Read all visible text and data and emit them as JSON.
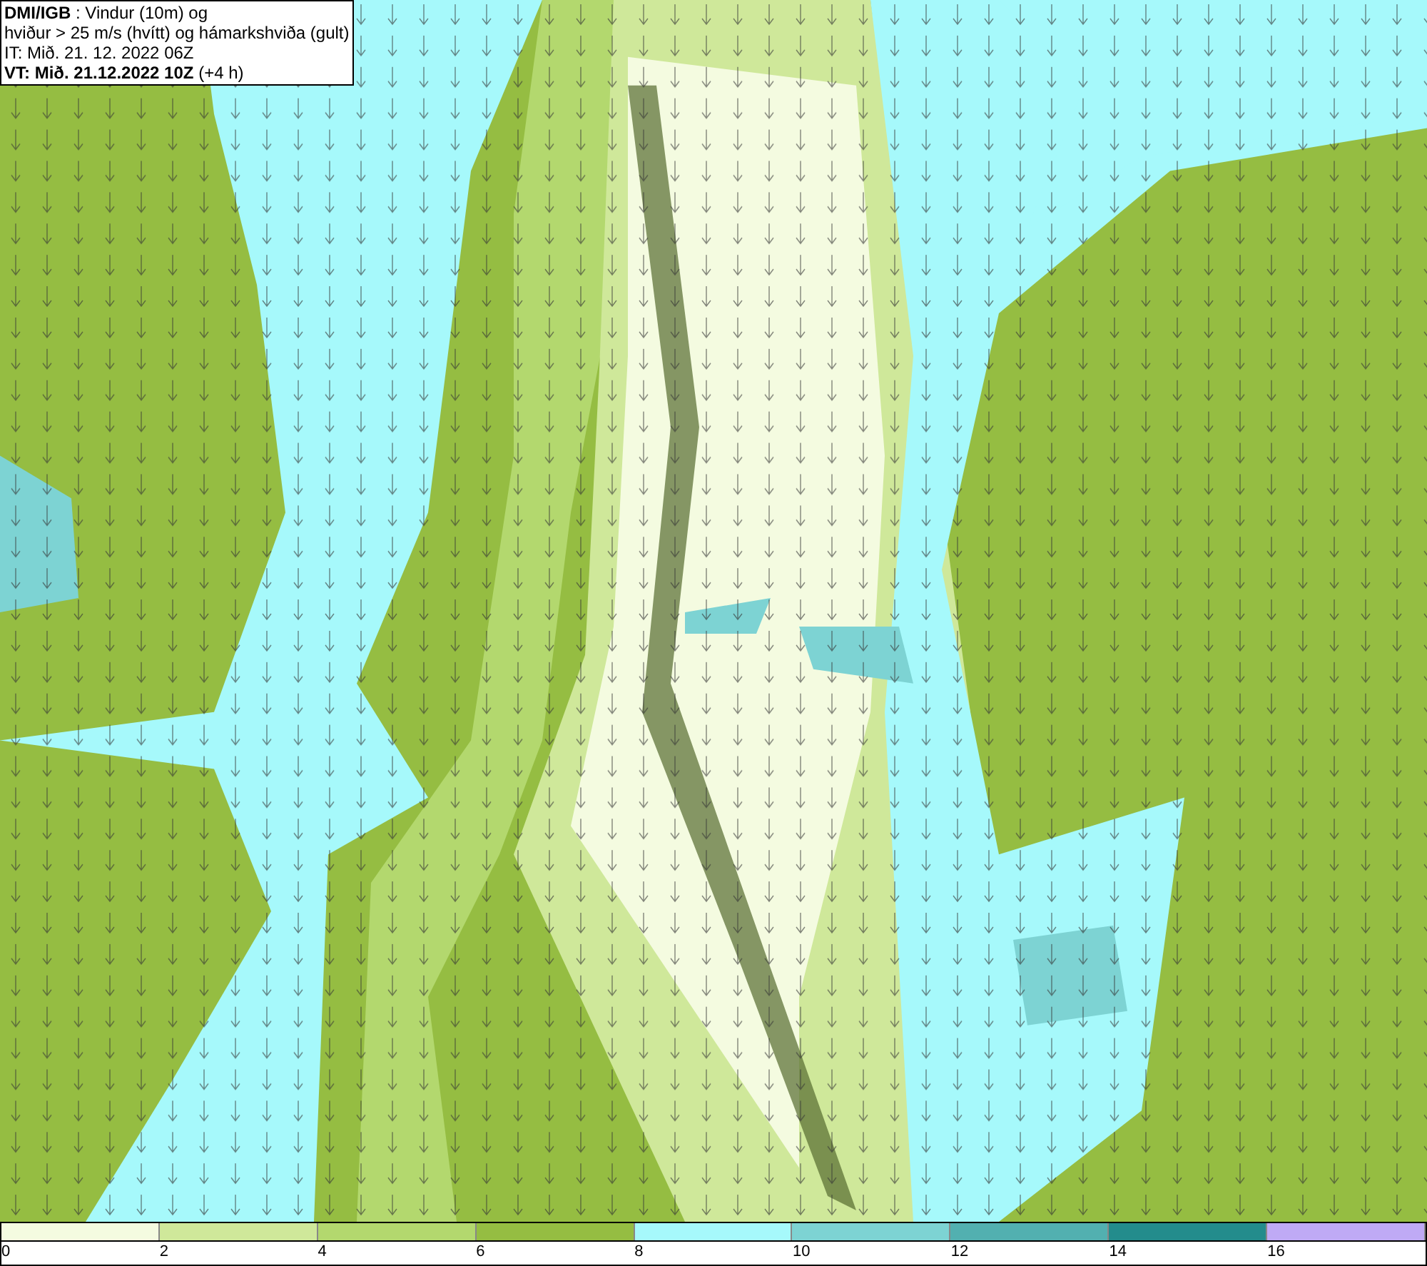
{
  "header": {
    "lines": [
      "**DMI/IGB** : Vindur (10m) og",
      "hviður > 25 m/s (hvítt) og hámarkshviða (gult)",
      "IT: Mið. 21. 12. 2022 06Z",
      "**VT: Mið. 21.12.2022 10Z** (+4 h)"
    ]
  },
  "legend": {
    "bins": [
      {
        "color": "#f4fbe0"
      },
      {
        "color": "#cfe89a"
      },
      {
        "color": "#b3d86e"
      },
      {
        "color": "#95bd42"
      },
      {
        "color": "#a6f9fb"
      },
      {
        "color": "#7dd3d3"
      },
      {
        "color": "#52b0b0"
      },
      {
        "color": "#238c8c"
      },
      {
        "color": "#bfaaf5"
      }
    ],
    "ticks": [
      "0",
      "2",
      "4",
      "6",
      "8",
      "10",
      "12",
      "14",
      "16"
    ]
  }
}
